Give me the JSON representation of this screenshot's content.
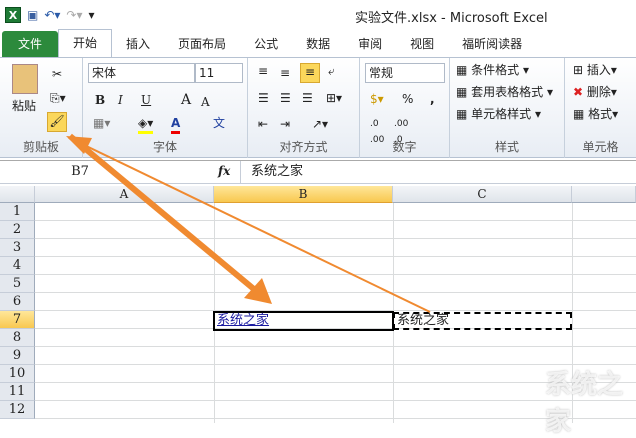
{
  "window": {
    "title": "实验文件.xlsx - Microsoft Excel",
    "app_icon": "X"
  },
  "tabs": [
    {
      "label": "文件"
    },
    {
      "label": "开始"
    },
    {
      "label": "插入"
    },
    {
      "label": "页面布局"
    },
    {
      "label": "公式"
    },
    {
      "label": "数据"
    },
    {
      "label": "审阅"
    },
    {
      "label": "视图"
    },
    {
      "label": "福昕阅读器"
    }
  ],
  "ribbon": {
    "clipboard": {
      "label": "剪贴板",
      "paste": "粘贴"
    },
    "font": {
      "label": "字体",
      "font_name": "宋体",
      "font_size": "11",
      "bold": "B",
      "italic": "I",
      "underline": "U",
      "grow": "A",
      "shrink": "A",
      "color": "A",
      "phonetic": "文"
    },
    "alignment": {
      "label": "对齐方式"
    },
    "number": {
      "label": "数字",
      "format": "常规",
      "percent": "%",
      "comma": ","
    },
    "styles": {
      "label": "样式",
      "conditional": "条件格式",
      "table": "套用表格格式",
      "cell_styles": "单元格样式"
    },
    "cells": {
      "label": "单元格",
      "insert": "插入",
      "delete": "删除",
      "format": "格式"
    }
  },
  "formula_bar": {
    "name_box": "B7",
    "fx": "fx",
    "value": "系统之家"
  },
  "columns": [
    "A",
    "B",
    "C"
  ],
  "rows": [
    "1",
    "2",
    "3",
    "4",
    "5",
    "6",
    "7",
    "8",
    "9",
    "10",
    "11",
    "12"
  ],
  "cells": {
    "B7": "系统之家",
    "C7": "系统之家"
  },
  "watermark": "系统之家",
  "colors": {
    "accent": "#f08a30",
    "file_tab": "#2c8a3c",
    "selected_header": "#f8c850"
  }
}
